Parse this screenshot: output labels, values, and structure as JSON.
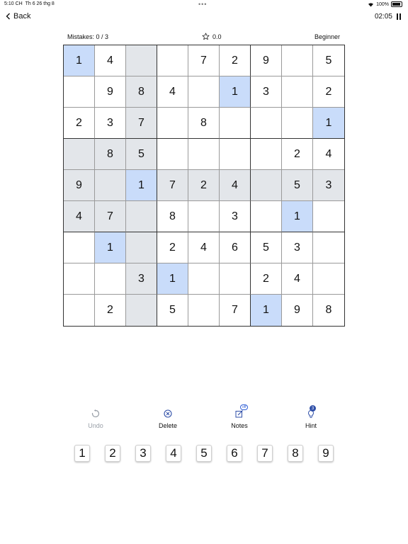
{
  "status_bar": {
    "time": "5:10 CH",
    "date": "Th 6 26 thg 8",
    "battery": "100%"
  },
  "header": {
    "back_label": "Back",
    "timer": "02:05"
  },
  "info": {
    "mistakes": "Mistakes: 0 / 3",
    "score": "0.0",
    "difficulty": "Beginner"
  },
  "board": {
    "cells": [
      [
        "1",
        "4",
        "",
        "",
        "7",
        "2",
        "9",
        "",
        "5"
      ],
      [
        "",
        "9",
        "8",
        "4",
        "",
        "1",
        "3",
        "",
        "2"
      ],
      [
        "2",
        "3",
        "7",
        "",
        "8",
        "",
        "",
        "",
        "1"
      ],
      [
        "",
        "8",
        "5",
        "",
        "",
        "",
        "",
        "2",
        "4"
      ],
      [
        "9",
        "",
        "1",
        "7",
        "2",
        "4",
        "",
        "5",
        "3"
      ],
      [
        "4",
        "7",
        "",
        "8",
        "",
        "3",
        "",
        "1",
        ""
      ],
      [
        "",
        "1",
        "",
        "2",
        "4",
        "6",
        "5",
        "3",
        ""
      ],
      [
        "",
        "",
        "3",
        "1",
        "",
        "",
        "2",
        "4",
        ""
      ],
      [
        "",
        "2",
        "",
        "5",
        "",
        "7",
        "1",
        "9",
        "8"
      ]
    ],
    "selected_row": 4,
    "selected_col": 2,
    "highlight_value": "1"
  },
  "toolbar": {
    "undo_label": "Undo",
    "delete_label": "Delete",
    "notes_label": "Notes",
    "notes_state": "off",
    "hint_label": "Hint",
    "hint_count": "3"
  },
  "numpad": {
    "keys": [
      "1",
      "2",
      "3",
      "4",
      "5",
      "6",
      "7",
      "8",
      "9"
    ]
  },
  "colors": {
    "same_value": "#c9dcfa",
    "related": "#e3e6ea",
    "accent": "#2f5fd6"
  }
}
